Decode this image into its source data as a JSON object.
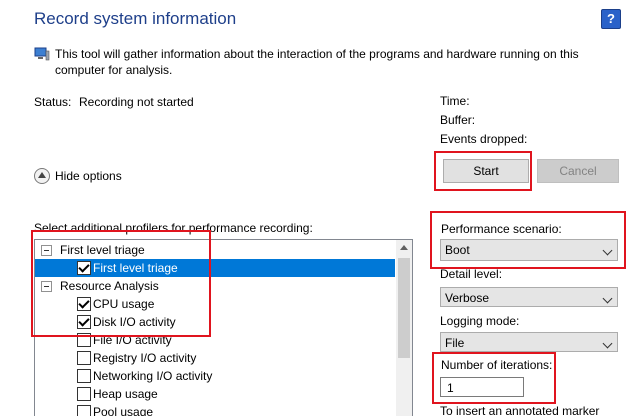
{
  "header": {
    "title": "Record system information",
    "help_glyph": "?"
  },
  "info": {
    "icon": "computer-icon",
    "text": "This tool will gather information about the interaction of the programs and hardware running on this computer for analysis."
  },
  "status": {
    "label": "Status:",
    "value": "Recording not started",
    "time_label": "Time:",
    "buffer_label": "Buffer:",
    "events_dropped_label": "Events dropped:"
  },
  "buttons": {
    "start": "Start",
    "cancel": "Cancel"
  },
  "options_toggle": {
    "label": "Hide options"
  },
  "profiles": {
    "label": "Select additional profilers for performance recording:",
    "items": [
      {
        "label": "First level triage",
        "type": "group",
        "expanded": true
      },
      {
        "label": "First level triage",
        "type": "item",
        "checked": true,
        "selected": true
      },
      {
        "label": "Resource Analysis",
        "type": "group",
        "expanded": true
      },
      {
        "label": "CPU usage",
        "type": "item",
        "checked": true
      },
      {
        "label": "Disk I/O activity",
        "type": "item",
        "checked": true
      },
      {
        "label": "File I/O activity",
        "type": "item",
        "checked": false
      },
      {
        "label": "Registry I/O activity",
        "type": "item",
        "checked": false
      },
      {
        "label": "Networking I/O activity",
        "type": "item",
        "checked": false
      },
      {
        "label": "Heap usage",
        "type": "item",
        "checked": false
      },
      {
        "label": "Pool usage",
        "type": "item",
        "checked": false
      }
    ]
  },
  "settings": {
    "scenario_label": "Performance scenario:",
    "scenario_value": "Boot",
    "detail_label": "Detail level:",
    "detail_value": "Verbose",
    "logging_label": "Logging mode:",
    "logging_value": "File",
    "iterations_label": "Number of iterations:",
    "iterations_value": "1",
    "marker_text": "To insert an annotated marker"
  },
  "colors": {
    "title": "#1e3f8a",
    "selection": "#0078d7",
    "highlight_box": "#e0141e"
  }
}
